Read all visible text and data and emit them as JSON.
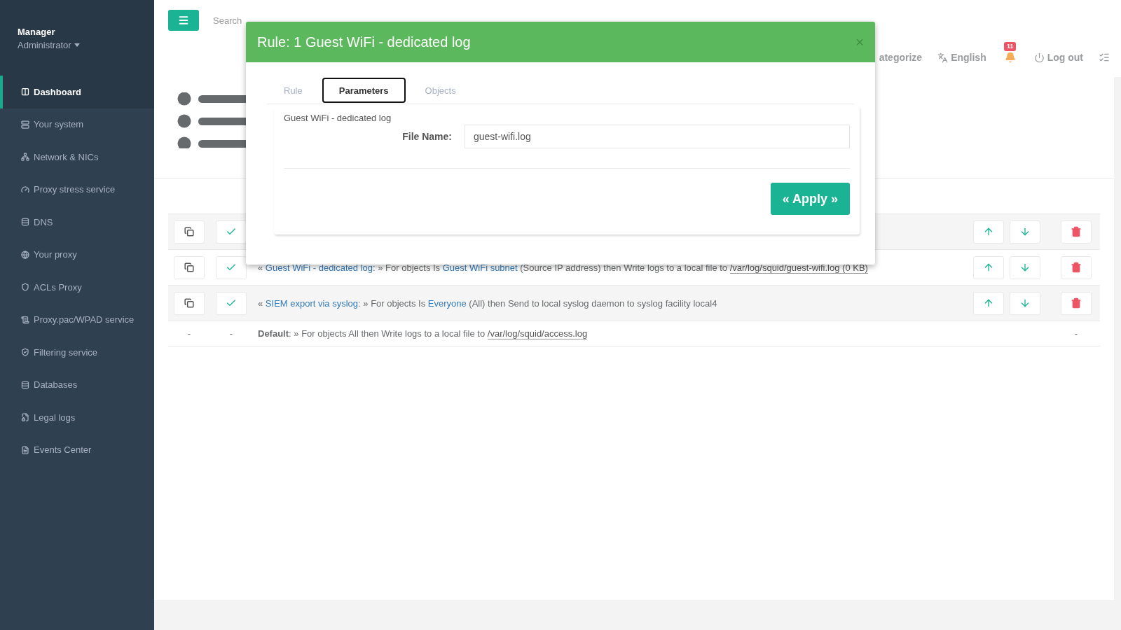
{
  "sidebar": {
    "user": {
      "name": "Manager",
      "role": "Administrator"
    },
    "items": [
      {
        "label": "Dashboard",
        "selected": true
      },
      {
        "label": "Your system",
        "selected": false
      },
      {
        "label": "Network & NICs",
        "selected": false
      },
      {
        "label": "Proxy stress service",
        "selected": false
      },
      {
        "label": "DNS",
        "selected": false
      },
      {
        "label": "Your proxy",
        "selected": false
      },
      {
        "label": "ACLs Proxy",
        "selected": false
      },
      {
        "label": "Proxy.pac/WPAD service",
        "selected": false
      },
      {
        "label": "Filtering service",
        "selected": false
      },
      {
        "label": "Databases",
        "selected": false
      },
      {
        "label": "Legal logs",
        "selected": false
      },
      {
        "label": "Events Center",
        "selected": false
      }
    ]
  },
  "topbar": {
    "search": {
      "placeholder": "Search"
    },
    "nav": [
      {
        "kind": "link",
        "label": "ategorize"
      },
      {
        "kind": "language",
        "label": "English"
      },
      {
        "kind": "notifications",
        "badge": "11"
      },
      {
        "kind": "logout",
        "label": "Log out"
      },
      {
        "kind": "tasks"
      }
    ]
  },
  "rules": {
    "rows": [
      {
        "kind": "rule",
        "enabled": true
      },
      {
        "kind": "rule",
        "enabled": true,
        "parts": [
          {
            "kind": "text",
            "text": "« "
          },
          {
            "kind": "link",
            "text": "Guest WiFi - dedicated log"
          },
          {
            "kind": "text",
            "text": ": » For objects Is "
          },
          {
            "kind": "link",
            "text": "Guest WiFi subnet"
          },
          {
            "kind": "text",
            "text": " (Source IP address) then Write logs to a local file to "
          },
          {
            "kind": "path",
            "text": "/var/log/squid/guest-wifi.log (0 KB)"
          }
        ]
      },
      {
        "kind": "rule",
        "enabled": true,
        "parts": [
          {
            "kind": "text",
            "text": "« "
          },
          {
            "kind": "link",
            "text": "SIEM export via syslog"
          },
          {
            "kind": "text",
            "text": ": » For objects Is "
          },
          {
            "kind": "link",
            "text": "Everyone"
          },
          {
            "kind": "text",
            "text": " (All) then Send to local syslog daemon to syslog facility local4"
          }
        ]
      },
      {
        "kind": "default",
        "cells": [
          "-",
          "-"
        ],
        "end": "-",
        "parts": [
          {
            "kind": "bold",
            "text": "Default"
          },
          {
            "kind": "text",
            "text": ": » For objects All then Write logs to a local file to "
          },
          {
            "kind": "path",
            "text": "/var/log/squid/access.log"
          }
        ]
      }
    ]
  },
  "modal": {
    "title": "Rule: 1 Guest WiFi - dedicated log",
    "close": "×",
    "tabs": [
      {
        "label": "Rule",
        "selected": false
      },
      {
        "label": "Parameters",
        "selected": true
      },
      {
        "label": "Objects",
        "selected": false
      }
    ],
    "panel": {
      "caption": "Guest WiFi - dedicated log",
      "field": {
        "label": "File Name:",
        "value": "guest-wifi.log"
      },
      "button": "« Apply »"
    }
  }
}
